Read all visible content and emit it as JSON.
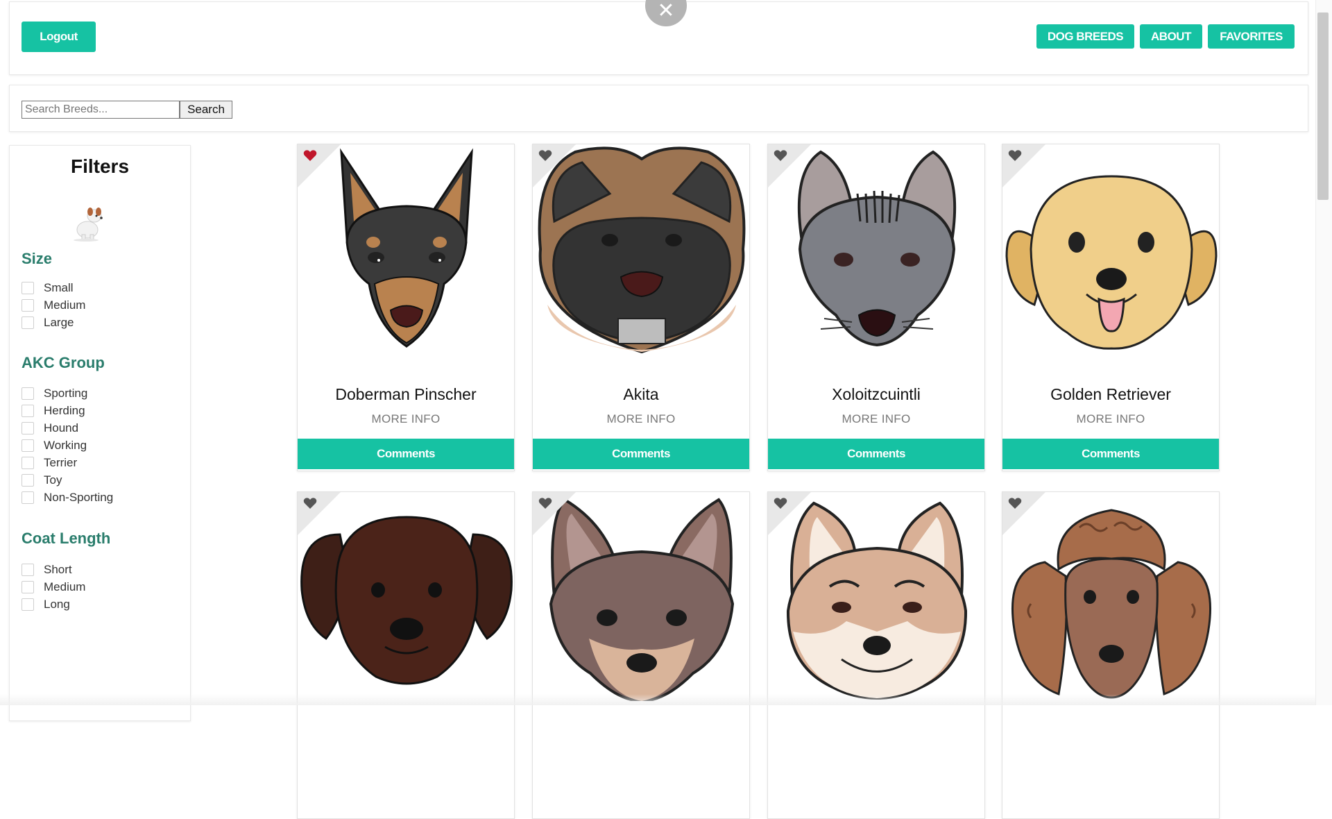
{
  "header": {
    "logout_label": "Logout",
    "nav": [
      "DOG BREEDS",
      "ABOUT",
      "FAVORITES"
    ]
  },
  "search": {
    "placeholder": "Search Breeds...",
    "value": "",
    "button_label": "Search"
  },
  "filters": {
    "title": "Filters",
    "groups": [
      {
        "title": "Size",
        "options": [
          "Small",
          "Medium",
          "Large"
        ]
      },
      {
        "title": "AKC Group",
        "options": [
          "Sporting",
          "Herding",
          "Hound",
          "Working",
          "Terrier",
          "Toy",
          "Non-Sporting"
        ]
      },
      {
        "title": "Coat Length",
        "options": [
          "Short",
          "Medium",
          "Long"
        ]
      }
    ]
  },
  "cards": [
    {
      "name": "Doberman Pinscher",
      "more": "MORE INFO",
      "comments": "Comments",
      "favorite": true
    },
    {
      "name": "Akita",
      "more": "MORE INFO",
      "comments": "Comments",
      "favorite": false
    },
    {
      "name": "Xoloitzcuintli",
      "more": "MORE INFO",
      "comments": "Comments",
      "favorite": false
    },
    {
      "name": "Golden Retriever",
      "more": "MORE INFO",
      "comments": "Comments",
      "favorite": false
    },
    {
      "favorite": false
    },
    {
      "favorite": false
    },
    {
      "favorite": false
    },
    {
      "favorite": false
    }
  ],
  "colors": {
    "accent": "#16c2a3",
    "group_title": "#2a7d6c",
    "heart_favorite": "#c0162b",
    "heart_default": "#555555"
  },
  "icons": {
    "close": "close-icon",
    "heart": "heart-icon"
  }
}
